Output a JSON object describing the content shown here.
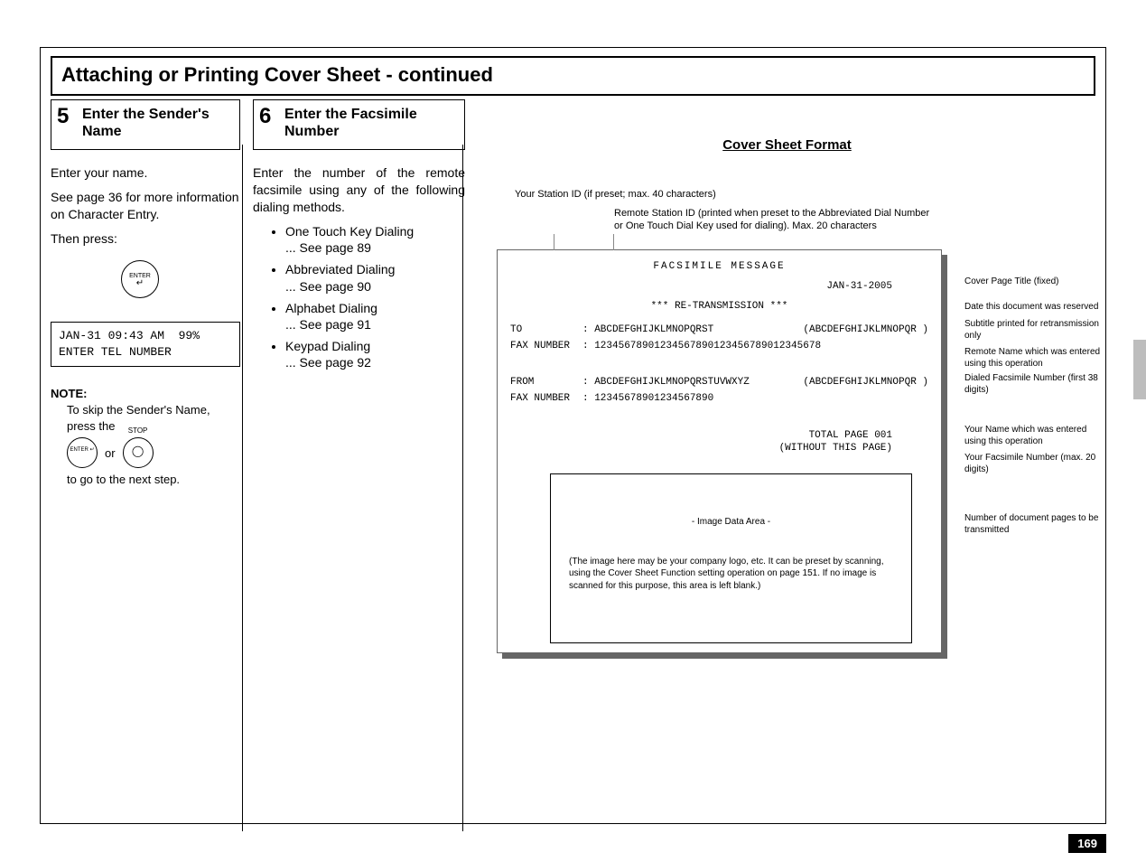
{
  "header": "Attaching or Printing Cover Sheet - continued",
  "step5": {
    "num": "5",
    "title": "Enter the Sender's Name",
    "p1": "Enter your name.",
    "p2": "See page 36 for more information on Character Entry.",
    "p3": "Then press:",
    "enter_label": "ENTER",
    "lcd_line1": "JAN-31 09:43 AM  99%",
    "lcd_line2": "ENTER TEL NUMBER",
    "note_heading": "NOTE:",
    "note_body1": "To skip the Sender's Name, press the",
    "or": "or",
    "stop_label": "STOP",
    "note_body2": "to go to the next step."
  },
  "step6": {
    "num": "6",
    "title": "Enter the Facsimile Number",
    "p1": "Enter the number of the remote facsimile using any of the following dialing methods.",
    "items": [
      {
        "name": "One Touch Key Dialing",
        "ref": "... See page 89"
      },
      {
        "name": "Abbreviated Dialing",
        "ref": "... See page 90"
      },
      {
        "name": "Alphabet Dialing",
        "ref": "... See page 91"
      },
      {
        "name": "Keypad Dialing",
        "ref": "... See page 92"
      }
    ]
  },
  "cover_sheet": {
    "heading": "Cover Sheet Format",
    "station_id_note": "Your Station ID (if preset; max. 40 characters)",
    "remote_id_note": "Remote Station ID (printed when preset to the Abbreviated Dial Number or One Touch Dial Key used for dialing).  Max. 20 characters",
    "fax_title": "FACSIMILE MESSAGE",
    "date": "JAN-31-2005",
    "subtitle": "*** RE-TRANSMISSION ***",
    "to_lbl": "TO",
    "to_val": ": ABCDEFGHIJKLMNOPQRST",
    "to_paren": "(ABCDEFGHIJKLMNOPQR )",
    "faxnum_lbl": "FAX NUMBER",
    "faxnum1": ": 12345678901234567890123456789012345678",
    "from_lbl": "FROM",
    "from_val": ": ABCDEFGHIJKLMNOPQRSTUVWXYZ",
    "from_paren": "(ABCDEFGHIJKLMNOPQR )",
    "faxnum2": ": 12345678901234567890",
    "total_line1": "TOTAL  PAGE   001",
    "total_line2": "(WITHOUT THIS PAGE)",
    "image_title": "- Image Data Area -",
    "image_text": "(The image here may be your company logo, etc.  It can be preset by scanning, using the Cover Sheet Function setting operation on page 151.  If no image is scanned for this purpose, this area is left blank.)"
  },
  "callouts": {
    "c1": "Cover Page Title (fixed)",
    "c2": "Date this document was reserved",
    "c3": "Subtitle printed for retransmission only",
    "c4": "Remote Name which was entered using this operation",
    "c5": "Dialed Facsimile Number (first 38 digits)",
    "c6": "Your Name which was entered using this operation",
    "c7": "Your Facsimile Number (max. 20 digits)",
    "c8": "Number of document pages to be transmitted"
  },
  "page_number": "169"
}
